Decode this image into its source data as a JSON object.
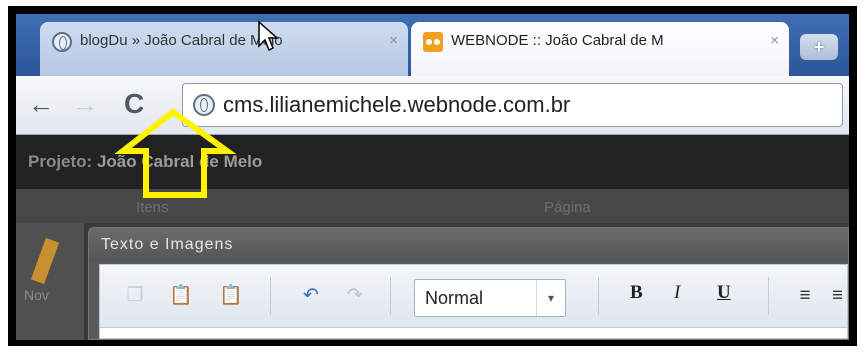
{
  "browser": {
    "tabs": [
      {
        "label": "blogDu » João Cabral de Melo",
        "close": "×",
        "icon": "globe-icon",
        "active": false
      },
      {
        "label": "WEBNODE :: João Cabral de M",
        "close": "×",
        "icon": "webnode-icon",
        "active": true
      }
    ],
    "new_tab_label": "+",
    "nav": {
      "back": "←",
      "forward": "→",
      "reload": "C"
    },
    "address": "cms.lilianemichele.webnode.com.br"
  },
  "page": {
    "project_label": "Projeto:",
    "project_name": "João Cabral de Melo",
    "columns": [
      "Itens",
      "Página"
    ],
    "side_label": "Nov",
    "dialog_title": "Texto e Imagens",
    "editor_toolbar": {
      "style_value": "Normal",
      "dropdown_arrow": "▾",
      "bold": "B",
      "italic": "I",
      "underline": "U"
    }
  },
  "annotation": {
    "arrow_color": "#FFF200"
  }
}
